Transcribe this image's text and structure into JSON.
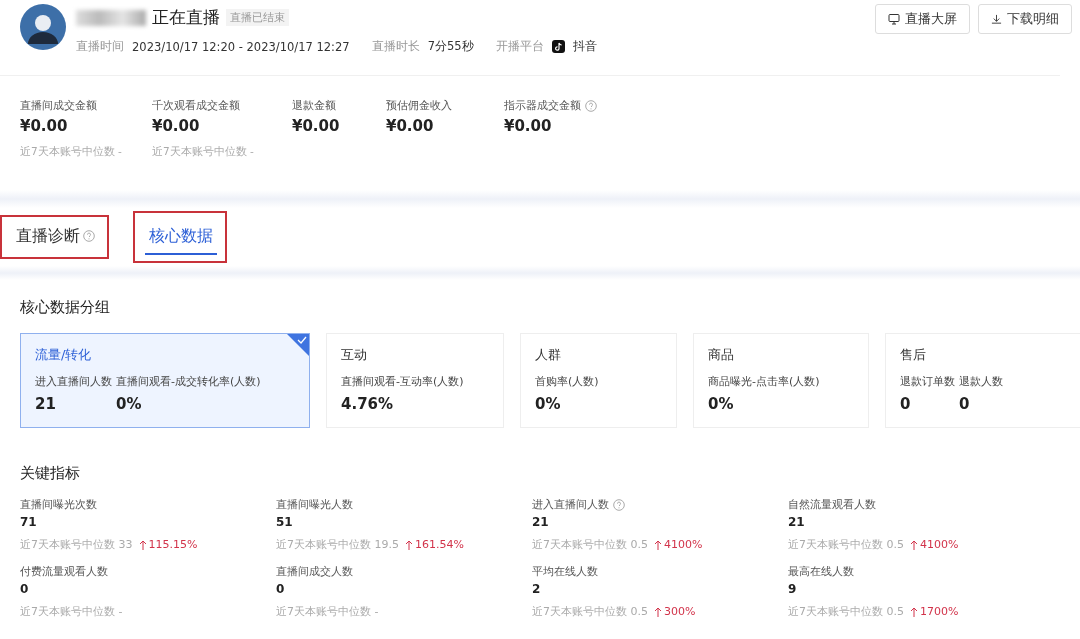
{
  "header": {
    "title": "正在直播",
    "status": "直播已结束",
    "meta": [
      {
        "label": "直播时间",
        "value": "2023/10/17 12:20 - 2023/10/17 12:27",
        "kind": "text"
      },
      {
        "label": "直播时长",
        "value": "7分55秒",
        "kind": "text"
      },
      {
        "label": "开播平台",
        "value": "抖音",
        "kind": "platform"
      }
    ],
    "buttons": [
      {
        "label": "直播大屏",
        "kind": "screen"
      },
      {
        "label": "下载明细",
        "kind": "download"
      }
    ]
  },
  "summary": [
    {
      "label": "直播间成交金额",
      "value": "¥0.00",
      "median": "近7天本账号中位数 -",
      "help": false
    },
    {
      "label": "千次观看成交金额",
      "value": "¥0.00",
      "median": "近7天本账号中位数 -",
      "help": false
    },
    {
      "label": "退款金额",
      "value": "¥0.00",
      "help": false
    },
    {
      "label": "预估佣金收入",
      "value": "¥0.00",
      "help": false
    },
    {
      "label": "指示器成交金额",
      "value": "¥0.00",
      "help": true
    }
  ],
  "tabs": [
    {
      "label": "直播诊断",
      "selected": false,
      "help": true
    },
    {
      "label": "核心数据",
      "selected": true,
      "help": false
    }
  ],
  "groups": {
    "title": "核心数据分组",
    "cards": [
      {
        "title": "流量/转化",
        "selected": true,
        "metrics": [
          {
            "label": "进入直播间人数",
            "value": "21"
          },
          {
            "label": "直播间观看-成交转化率(人数)",
            "value": "0%"
          }
        ]
      },
      {
        "title": "互动",
        "selected": false,
        "metrics": [
          {
            "label": "直播间观看-互动率(人数)",
            "value": "4.76%"
          }
        ]
      },
      {
        "title": "人群",
        "selected": false,
        "metrics": [
          {
            "label": "首购率(人数)",
            "value": "0%"
          }
        ]
      },
      {
        "title": "商品",
        "selected": false,
        "metrics": [
          {
            "label": "商品曝光-点击率(人数)",
            "value": "0%"
          }
        ]
      },
      {
        "title": "售后",
        "selected": false,
        "metrics": [
          {
            "label": "退款订单数",
            "value": "0"
          },
          {
            "label": "退款人数",
            "value": "0"
          }
        ]
      }
    ]
  },
  "key_metrics": {
    "title": "关键指标",
    "items": [
      {
        "label": "直播间曝光次数",
        "value": "71",
        "median": "近7天本账号中位数 33",
        "change": "115.15%",
        "help": false
      },
      {
        "label": "直播间曝光人数",
        "value": "51",
        "median": "近7天本账号中位数 19.5",
        "change": "161.54%",
        "help": false
      },
      {
        "label": "进入直播间人数",
        "value": "21",
        "median": "近7天本账号中位数 0.5",
        "change": "4100%",
        "help": true
      },
      {
        "label": "自然流量观看人数",
        "value": "21",
        "median": "近7天本账号中位数 0.5",
        "change": "4100%",
        "help": false
      },
      {
        "label": "付费流量观看人数",
        "value": "0",
        "median": "近7天本账号中位数 -",
        "help": false
      },
      {
        "label": "直播间成交人数",
        "value": "0",
        "median": "近7天本账号中位数 -",
        "help": false
      },
      {
        "label": "平均在线人数",
        "value": "2",
        "median": "近7天本账号中位数 0.5",
        "change": "300%",
        "help": false
      },
      {
        "label": "最高在线人数",
        "value": "9",
        "median": "近7天本账号中位数 0.5",
        "change": "1700%",
        "help": false
      }
    ]
  }
}
